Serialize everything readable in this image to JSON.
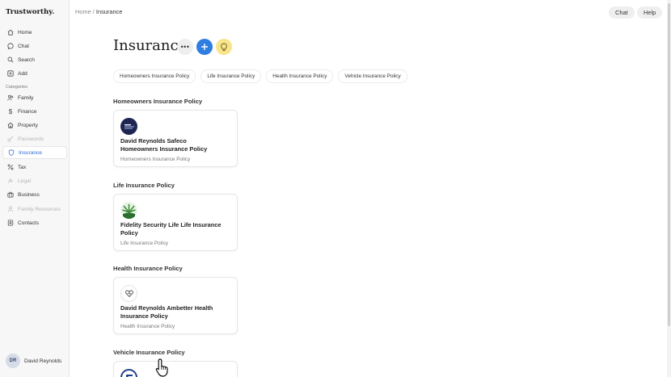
{
  "app": {
    "logo": "Trustworthy."
  },
  "breadcrumb": {
    "home": "Home",
    "sep": "/",
    "current": "Insurance"
  },
  "header": {
    "chat_label": "Chat",
    "help_label": "Help"
  },
  "sidebar": {
    "items": [
      {
        "label": "Home",
        "icon": "home-icon"
      },
      {
        "label": "Chat",
        "icon": "chat-icon"
      },
      {
        "label": "Search",
        "icon": "search-icon"
      },
      {
        "label": "Add",
        "icon": "add-icon"
      }
    ],
    "categories_label": "Categories",
    "categories": [
      {
        "label": "Family",
        "icon": "family-icon",
        "state": "normal"
      },
      {
        "label": "Finance",
        "icon": "dollar-icon",
        "state": "normal"
      },
      {
        "label": "Property",
        "icon": "property-icon",
        "state": "normal"
      },
      {
        "label": "Passwords",
        "icon": "key-icon",
        "state": "disabled"
      },
      {
        "label": "Insurance",
        "icon": "shield-icon",
        "state": "active"
      },
      {
        "label": "Tax",
        "icon": "percent-icon",
        "state": "normal"
      },
      {
        "label": "Legal",
        "icon": "gavel-icon",
        "state": "disabled"
      },
      {
        "label": "Business",
        "icon": "briefcase-icon",
        "state": "normal"
      },
      {
        "label": "Family Resources",
        "icon": "people-icon",
        "state": "disabled"
      },
      {
        "label": "Contacts",
        "icon": "contacts-icon",
        "state": "normal"
      }
    ]
  },
  "user": {
    "initials": "DR",
    "name": "David Reynolds"
  },
  "page": {
    "title": "Insurance"
  },
  "tabs": [
    "Homeowners Insurance Policy",
    "Life Insurance Policy",
    "Health Insurance Policy",
    "Vehicle Insurance Policy"
  ],
  "sections": [
    {
      "title": "Homeowners Insurance Policy",
      "card_title": "David Reynolds Safeco Homeowners Insurance Policy",
      "card_sub": "Homeowners Insurance Policy"
    },
    {
      "title": "Life Insurance Policy",
      "card_title": "Fidelity Security Life Life Insurance Policy",
      "card_sub": "Life Insurance Policy"
    },
    {
      "title": "Health Insurance Policy",
      "card_title": "David Reynolds Ambetter Health Insurance Policy",
      "card_sub": "Health Insurance Policy"
    },
    {
      "title": "Vehicle Insurance Policy",
      "card_title": "",
      "card_sub": ""
    }
  ],
  "colors": {
    "accent_blue": "#2f7de1",
    "bulb_yellow": "#f7e48c",
    "active_text": "#2a6bd6"
  }
}
